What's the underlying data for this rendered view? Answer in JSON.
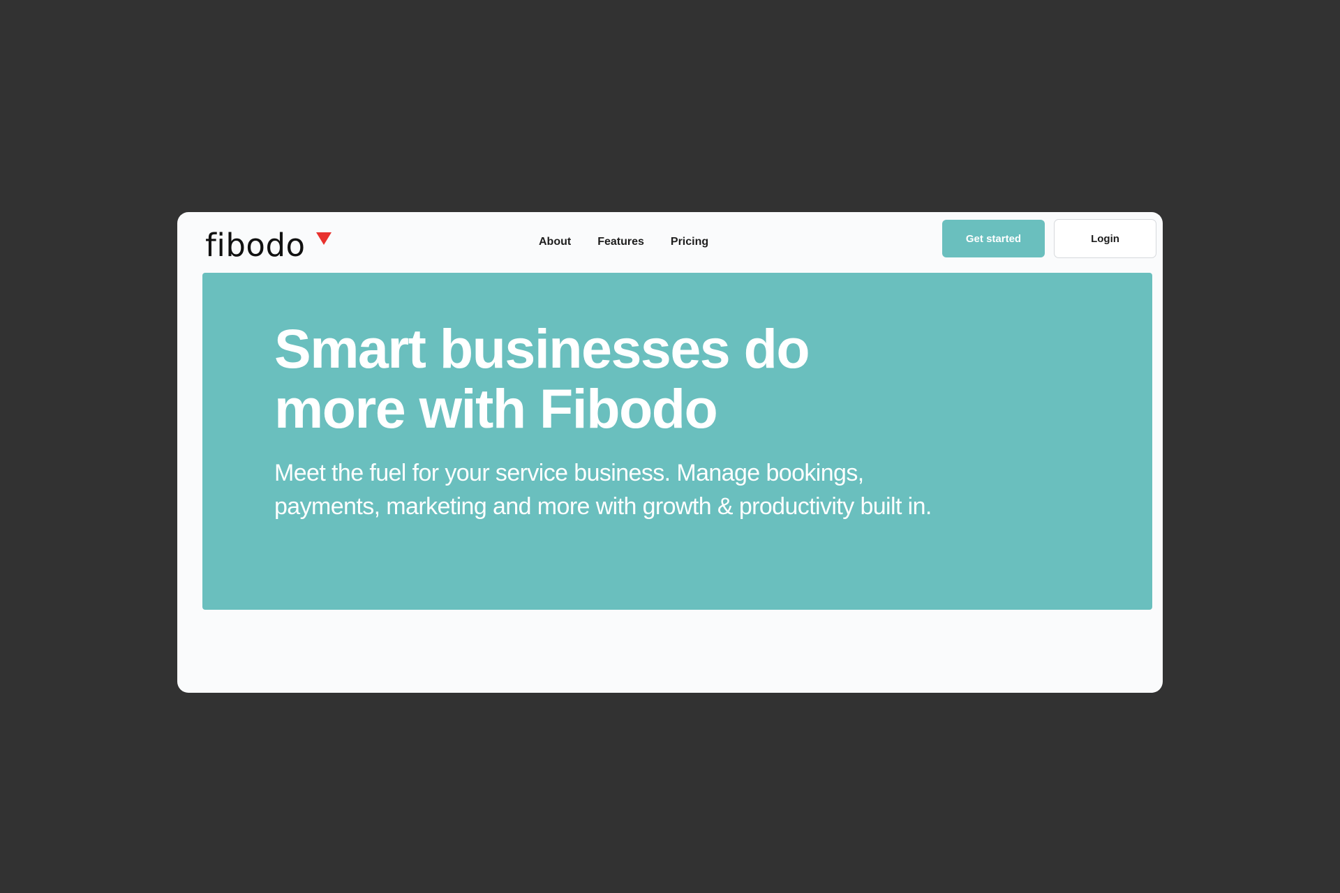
{
  "brand": {
    "name": "fibodo",
    "accent_color": "#e8322e",
    "primary_color": "#6abfbe"
  },
  "nav": {
    "items": [
      {
        "label": "About"
      },
      {
        "label": "Features"
      },
      {
        "label": "Pricing"
      }
    ]
  },
  "actions": {
    "primary_label": "Get started",
    "secondary_label": "Login"
  },
  "hero": {
    "title": "Smart businesses do more with Fibodo",
    "subtitle": "Meet the fuel for your service business. Manage bookings, payments, marketing and more with growth & productivity built in."
  }
}
